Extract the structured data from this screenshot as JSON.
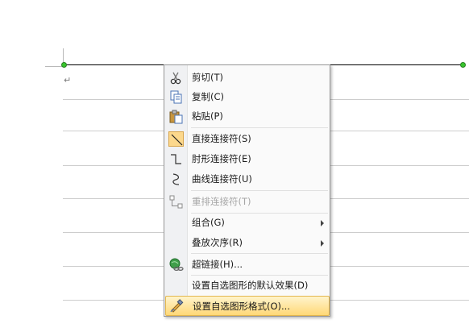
{
  "menu": {
    "items": [
      {
        "label": "剪切(T)",
        "icon": "scissors-icon"
      },
      {
        "label": "复制(C)",
        "icon": "copy-icon"
      },
      {
        "label": "粘贴(P)",
        "icon": "paste-icon"
      },
      {
        "label": "直接连接符(S)",
        "icon": "straight-connector-icon",
        "checked": true
      },
      {
        "label": "肘形连接符(E)",
        "icon": "elbow-connector-icon"
      },
      {
        "label": "曲线连接符(U)",
        "icon": "curved-connector-icon"
      },
      {
        "label": "重排连接符(T)",
        "icon": "reroute-connector-icon",
        "disabled": true
      },
      {
        "label": "组合(G)",
        "submenu": true
      },
      {
        "label": "叠放次序(R)",
        "submenu": true
      },
      {
        "label": "超链接(H)...",
        "icon": "hyperlink-icon"
      },
      {
        "label": "设置自选图形的默认效果(D)"
      },
      {
        "label": "设置自选图形格式(O)...",
        "icon": "format-shape-icon",
        "highlighted": true
      }
    ]
  },
  "document": {
    "paragraph_mark": "↵"
  },
  "colors": {
    "handle": "#37c52c",
    "highlight": "#ffd877",
    "menu_border": "#979797"
  }
}
